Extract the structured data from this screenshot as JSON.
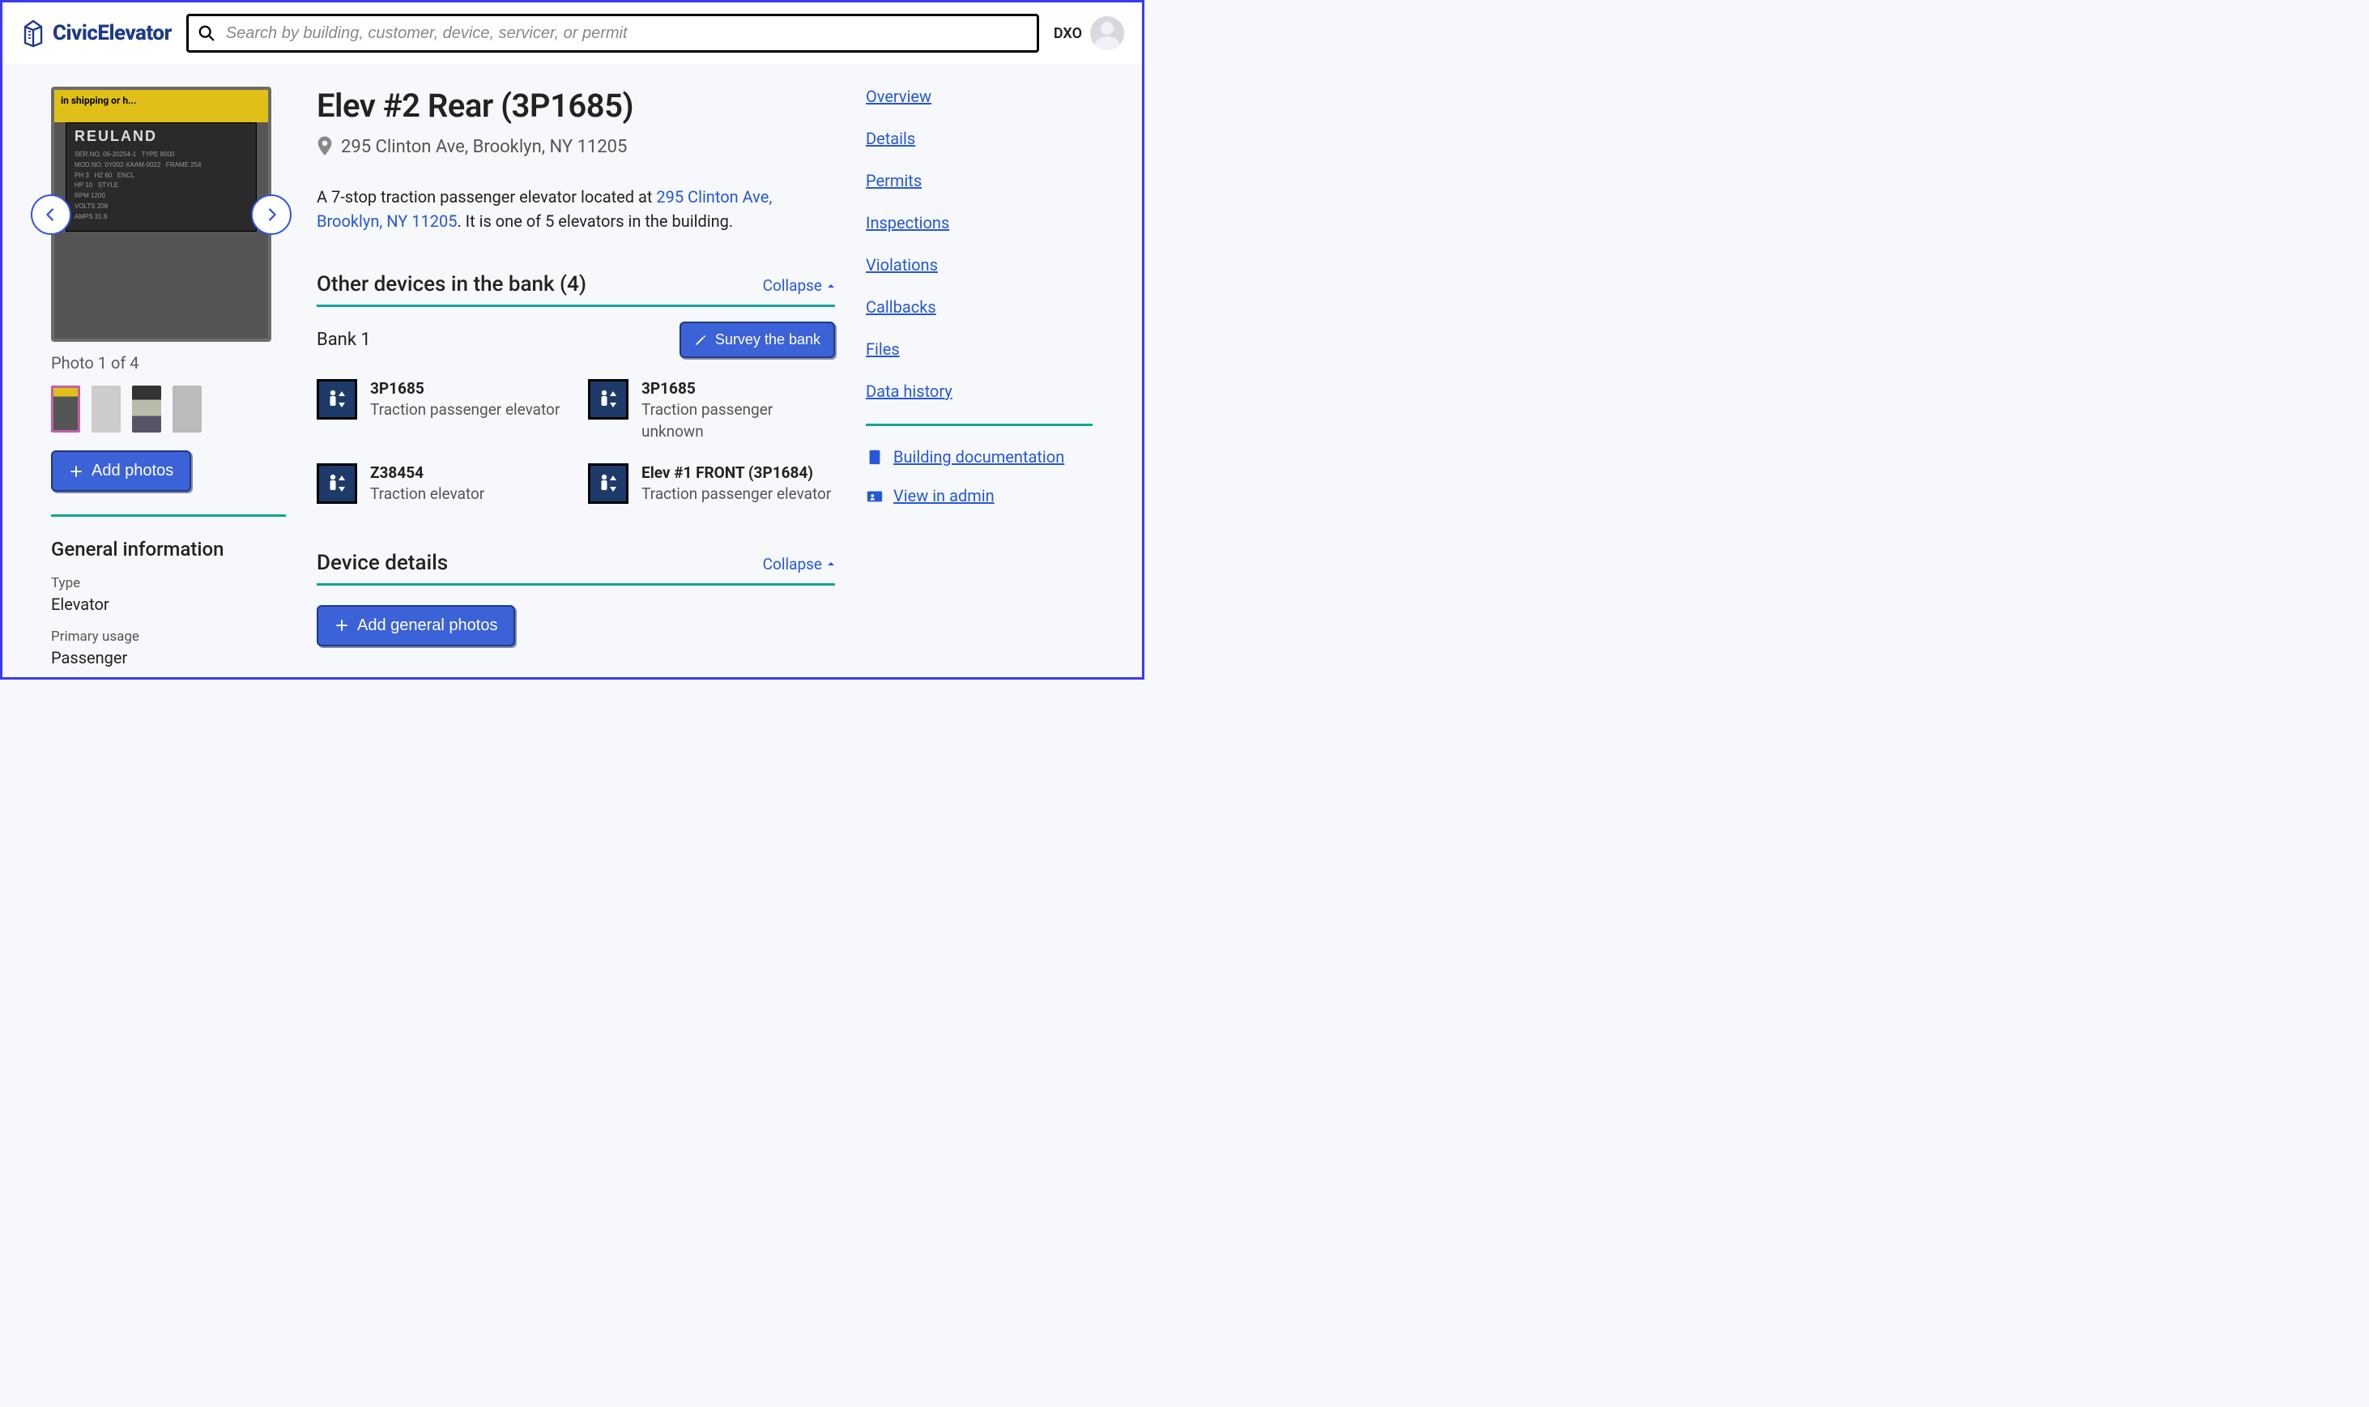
{
  "brand": "CivicElevator",
  "search": {
    "placeholder": "Search by building, customer, device, servicer, or permit"
  },
  "user": {
    "initials": "DXO"
  },
  "photo": {
    "counter": "Photo 1 of 4",
    "shipping_text": "in shipping or h...",
    "brand": "REULAND"
  },
  "buttons": {
    "add_photos": "Add photos",
    "survey_bank": "Survey the bank",
    "add_general_photos": "Add general photos"
  },
  "general_info": {
    "heading": "General information",
    "type_label": "Type",
    "type_value": "Elevator",
    "usage_label": "Primary usage",
    "usage_value": "Passenger"
  },
  "title": "Elev #2 Rear (3P1685)",
  "address": "295 Clinton Ave, Brooklyn, NY 11205",
  "description": {
    "prefix": "A 7-stop traction passenger elevator located at ",
    "link": "295 Clinton Ave, Brooklyn, NY 11205",
    "suffix": ". It is one of 5 elevators in the building."
  },
  "bank_section": {
    "heading": "Other devices in the bank (4)",
    "collapse": "Collapse",
    "bank_name": "Bank 1"
  },
  "devices": [
    {
      "name": "3P1685",
      "type": "Traction passenger elevator"
    },
    {
      "name": "3P1685",
      "type": "Traction passenger unknown"
    },
    {
      "name": "Z38454",
      "type": "Traction elevator"
    },
    {
      "name": "Elev #1 FRONT (3P1684)",
      "type": "Traction passenger elevator"
    }
  ],
  "details_section": {
    "heading": "Device details",
    "collapse": "Collapse"
  },
  "rnav": {
    "links": [
      "Overview",
      "Details",
      "Permits",
      "Inspections",
      "Violations",
      "Callbacks",
      "Files",
      "Data history"
    ],
    "building_docs": "Building documentation",
    "view_admin": "View in admin"
  }
}
